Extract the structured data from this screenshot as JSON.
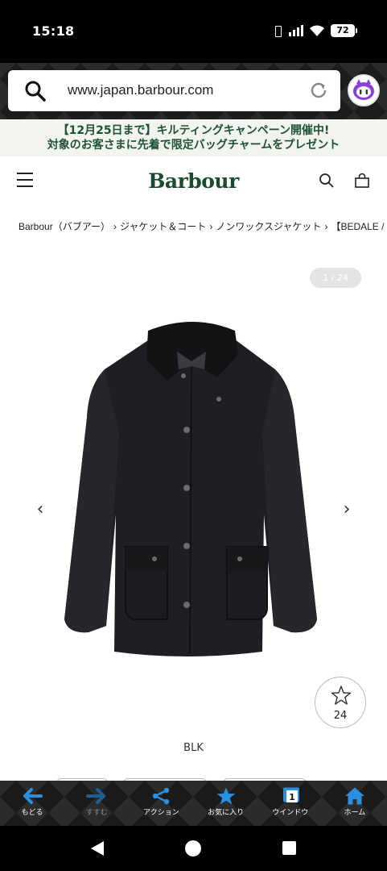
{
  "status_bar": {
    "time": "15:18",
    "battery": "72"
  },
  "browser": {
    "url": "www.japan.barbour.com"
  },
  "promo": {
    "line1": "【12月25日まで】キルティングキャンペーン開催中!",
    "line2": "対象のお客さまに先着で限定バッグチャームをプレゼント"
  },
  "header": {
    "logo": "Barbour"
  },
  "breadcrumb": {
    "items": [
      "Barbour（バブアー）",
      "ジャケット＆コート",
      "ノンワックスジャケット",
      "【BEDALE / "
    ],
    "separator": "›"
  },
  "gallery": {
    "counter": "1 / 24",
    "prev": "‹",
    "next": "›",
    "favorite_count": "24",
    "color_label": "BLK"
  },
  "toolbar": {
    "items": [
      {
        "label": "もどる",
        "icon": "back-arrow-icon",
        "enabled": true
      },
      {
        "label": "すすむ",
        "icon": "forward-arrow-icon",
        "enabled": false
      },
      {
        "label": "アクション",
        "icon": "share-icon",
        "enabled": true
      },
      {
        "label": "お気に入り",
        "icon": "star-icon",
        "enabled": true
      },
      {
        "label": "ウインドウ",
        "icon": "window-icon",
        "enabled": true,
        "badge": "1"
      },
      {
        "label": "ホーム",
        "icon": "home-icon",
        "enabled": true
      }
    ]
  },
  "colors": {
    "brand_green": "#1c4a2e",
    "toolbar_blue": "#2b8fe0"
  }
}
